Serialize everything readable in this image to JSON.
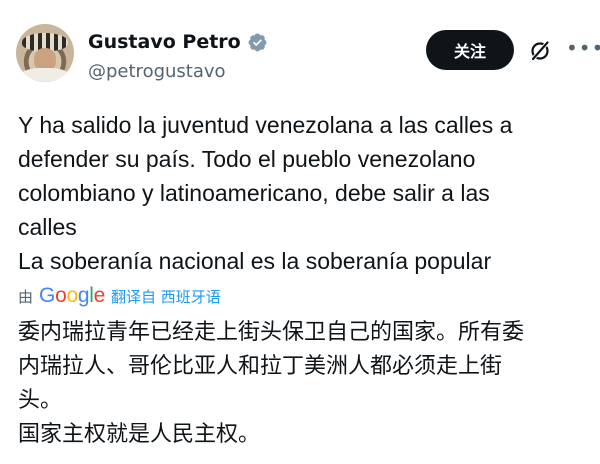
{
  "author": {
    "display_name": "Gustavo Petro",
    "handle": "@petrogustavo",
    "verified_color": "#829aab"
  },
  "actions": {
    "follow_label": "关注",
    "grok_icon": "grok-slash-icon",
    "more_icon": "more-horizontal-icon"
  },
  "tweet": {
    "lines": [
      "Y ha salido la juventud venezolana a las calles a",
      "defender su país. Todo el pueblo venezolano",
      "colombiano y latinoamericano, debe salir a las",
      "calles",
      "La soberanía nacional es la soberanía popular"
    ]
  },
  "translation": {
    "by_label": "由",
    "provider": "Google",
    "link_label": "翻译自 西班牙语",
    "lines": [
      "委内瑞拉青年已经走上街头保卫自己的国家。所有委",
      "内瑞拉人、哥伦比亚人和拉丁美洲人都必须走上街",
      "头。",
      "国家主权就是人民主权。"
    ]
  }
}
